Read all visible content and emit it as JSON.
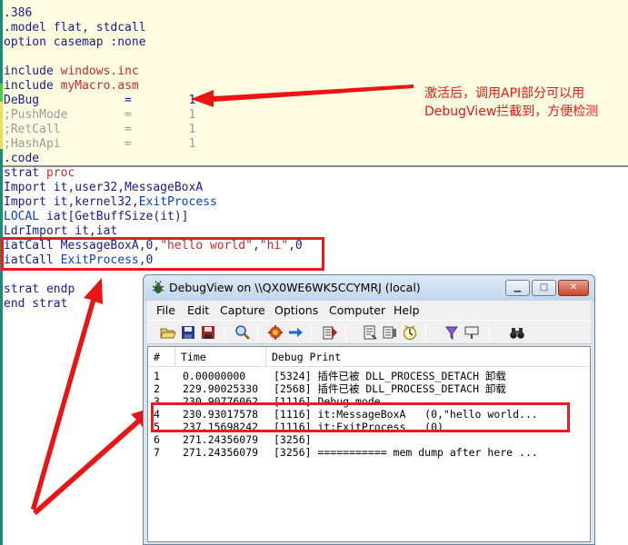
{
  "editor": {
    "lines_top": [
      {
        "t1": ".386"
      },
      {
        "t1": ".model",
        "t2": " flat, stdcall"
      },
      {
        "t1": "option",
        "t2": " casemap :none"
      },
      {
        "t1": ""
      },
      {
        "t1": "include",
        "t2": " windows.inc"
      },
      {
        "t1": "include",
        "t2": " myMacro.asm"
      },
      {
        "t1": "DeBug",
        "t2": "            =        1"
      },
      {
        "t1": ";PushMode",
        "t2": "        =        1"
      },
      {
        "t1": ";RetCall",
        "t2": "         =        1"
      },
      {
        "t1": ";HashApi",
        "t2": "         =        1"
      },
      {
        "t1": ".code"
      }
    ],
    "lines_bottom": {
      "l1a": "strat",
      "l1b": " proc",
      "l2a": "Import it,user32,MessageBoxA",
      "l3a": "Import it,kernel32,",
      "l3b": "ExitProcess",
      "l4a": "LOCAL",
      "l4b": " iat[GetBuffSize(it)]",
      "l5a": "LdrImport it,iat",
      "l6a": "iatCall MessageBoxA,0,",
      "l6b": "\"hello world\"",
      "l6c": ",",
      "l6d": "\"hi\"",
      "l6e": ",0",
      "l7a": "iatCall ",
      "l7b": "ExitProcess",
      "l7c": ",0",
      "l8a": "strat endp",
      "l9a": "end strat"
    }
  },
  "annotation": {
    "line1": "激活后，调用API部分可以用",
    "line2": "DebugView拦截到，方便检测"
  },
  "debugview": {
    "title": "DebugView on \\\\QX0WE6WK5CCYMRJ (local)",
    "menu": [
      "File",
      "Edit",
      "Capture",
      "Options",
      "Computer",
      "Help"
    ],
    "columns": [
      "#",
      "Time",
      "Debug Print"
    ],
    "rows": [
      {
        "num": "1",
        "time": "0.00000000",
        "msg": "[5324] 插件已被 DLL_PROCESS_DETACH 卸载"
      },
      {
        "num": "2",
        "time": "229.90025330",
        "msg": "[2568] 插件已被 DLL_PROCESS_DETACH 卸载"
      },
      {
        "num": "3",
        "time": "230.90776062",
        "msg": "[1116] Debug mode"
      },
      {
        "num": "4",
        "time": "230.93017578",
        "msg": "[1116] it:MessageBoxA   (0,\"hello world..."
      },
      {
        "num": "5",
        "time": "237.15698242",
        "msg": "[1116] it:ExitProcess   (0)"
      },
      {
        "num": "6",
        "time": "271.24356079",
        "msg": "[3256]"
      },
      {
        "num": "7",
        "time": "271.24356079",
        "msg": "[3256] =========== mem dump after here ..."
      }
    ],
    "toolbar_icons": [
      "open-icon",
      "save-icon",
      "save-all-icon",
      "find-icon",
      "capture-icon",
      "autoscroll-icon",
      "clear-icon",
      "filter-icon",
      "highlight-icon",
      "history-icon",
      "pin-icon",
      "bookmark-icon",
      "binoculars-icon"
    ]
  },
  "colors": {
    "annotation_red": "#ea1414",
    "keyword_blue": "#1a1a8a",
    "string_red": "#d22828",
    "highlight_bg": "#fefde2"
  }
}
